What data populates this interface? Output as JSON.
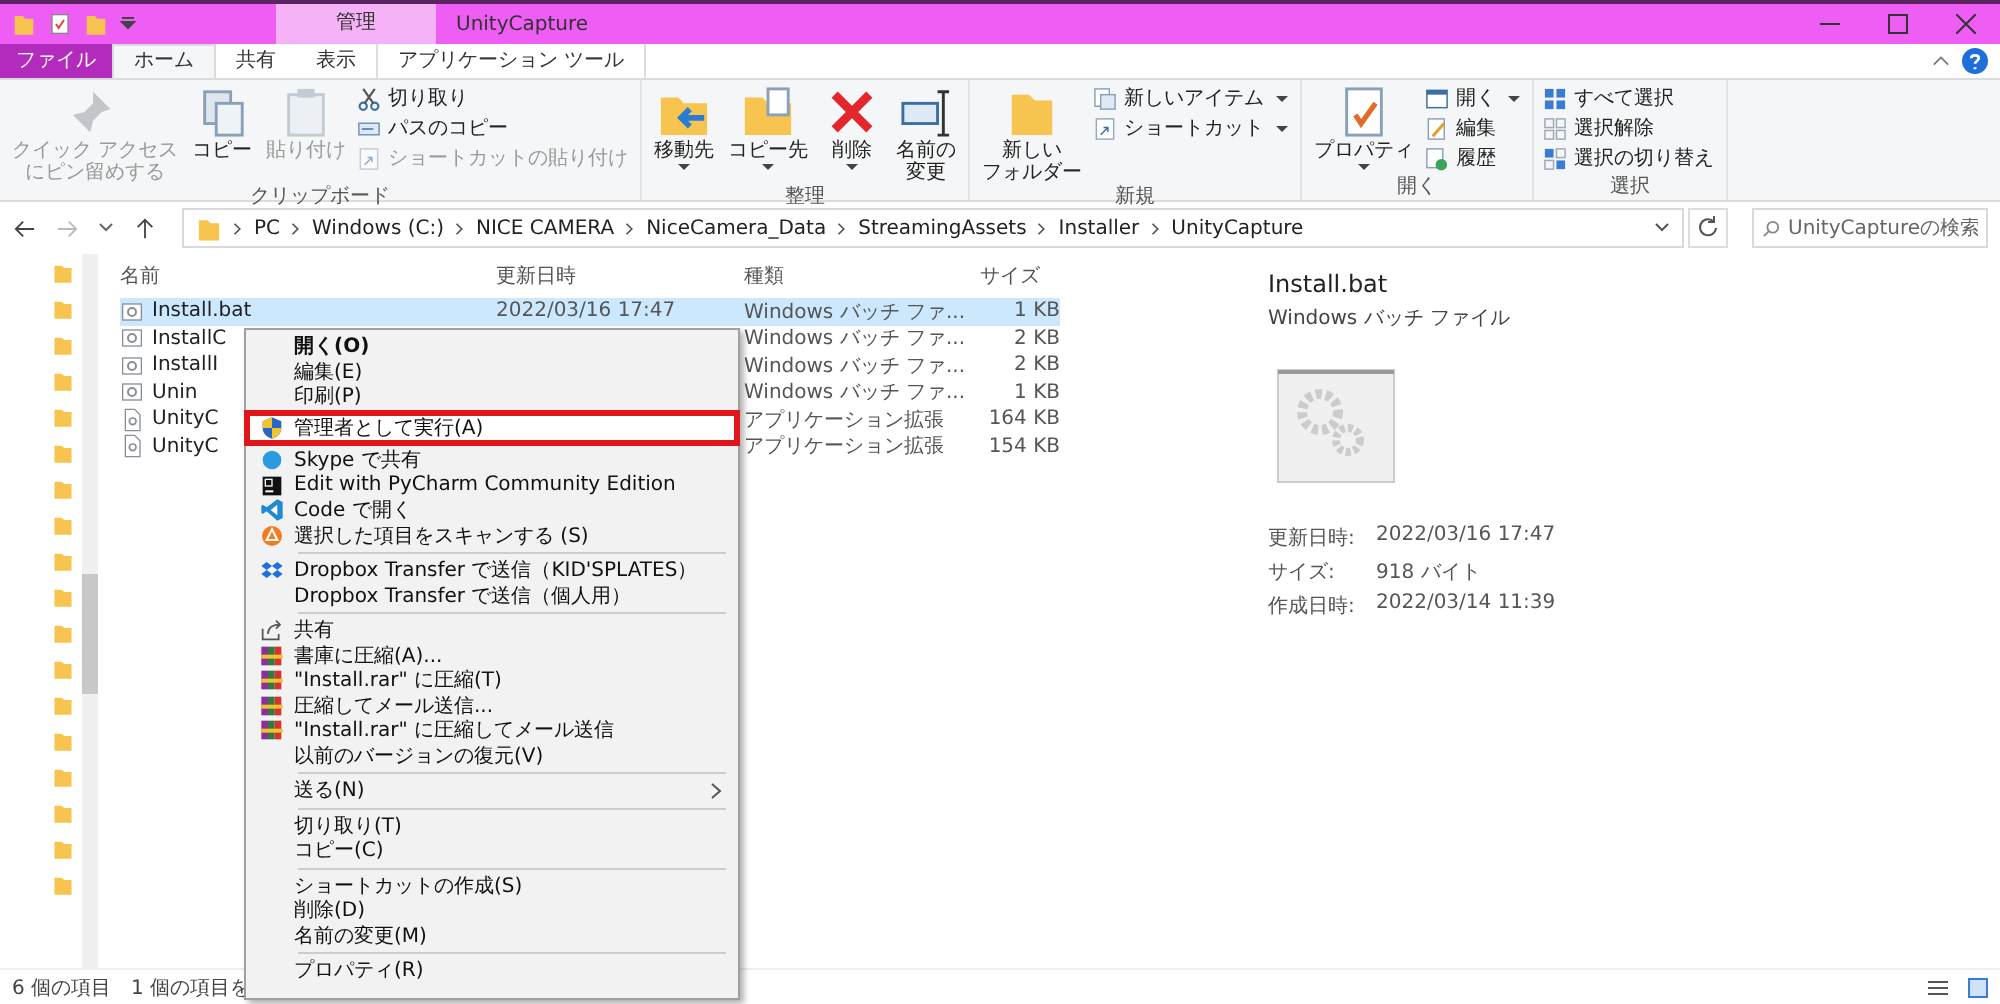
{
  "window": {
    "context_tab": "管理",
    "title": "UnityCapture"
  },
  "ribbon_tabs": [
    {
      "label": "ファイル",
      "kind": "file",
      "selected": false
    },
    {
      "label": "ホーム",
      "kind": "tab",
      "selected": true
    },
    {
      "label": "共有",
      "kind": "tab",
      "selected": false
    },
    {
      "label": "表示",
      "kind": "tab",
      "selected": false
    },
    {
      "label": "アプリケーション ツール",
      "kind": "context",
      "selected": false
    }
  ],
  "ribbon_groups": [
    {
      "label": "クリップボード",
      "controls": [
        {
          "kind": "large",
          "label": [
            "クイック アクセス",
            "にピン留めする"
          ],
          "disabled": true,
          "dropdown": false
        },
        {
          "kind": "large",
          "label": [
            "コピー"
          ],
          "disabled": false,
          "dropdown": false
        },
        {
          "kind": "large",
          "label": [
            "貼り付け"
          ],
          "disabled": true,
          "dropdown": false
        },
        {
          "kind": "stack",
          "items": [
            {
              "label": "切り取り",
              "disabled": false,
              "dropdown": false
            },
            {
              "label": "パスのコピー",
              "disabled": false,
              "dropdown": false
            },
            {
              "label": "ショートカットの貼り付け",
              "disabled": true,
              "dropdown": false
            }
          ]
        }
      ]
    },
    {
      "label": "整理",
      "controls": [
        {
          "kind": "large",
          "label": [
            "移動先"
          ],
          "disabled": false,
          "dropdown": true
        },
        {
          "kind": "large",
          "label": [
            "コピー先"
          ],
          "disabled": false,
          "dropdown": true
        },
        {
          "kind": "large",
          "label": [
            "削除"
          ],
          "disabled": false,
          "dropdown": true
        },
        {
          "kind": "large",
          "label": [
            "名前の",
            "変更"
          ],
          "disabled": false,
          "dropdown": false
        }
      ]
    },
    {
      "label": "新規",
      "controls": [
        {
          "kind": "large",
          "label": [
            "新しい",
            "フォルダー"
          ],
          "disabled": false,
          "dropdown": false
        },
        {
          "kind": "stack",
          "items": [
            {
              "label": "新しいアイテム",
              "disabled": false,
              "dropdown": true
            },
            {
              "label": "ショートカット",
              "disabled": false,
              "dropdown": true
            }
          ]
        }
      ]
    },
    {
      "label": "開く",
      "controls": [
        {
          "kind": "large",
          "label": [
            "プロパティ"
          ],
          "disabled": false,
          "dropdown": true
        },
        {
          "kind": "stack",
          "items": [
            {
              "label": "開く",
              "disabled": false,
              "dropdown": true
            },
            {
              "label": "編集",
              "disabled": false,
              "dropdown": false
            },
            {
              "label": "履歴",
              "disabled": false,
              "dropdown": false
            }
          ]
        }
      ]
    },
    {
      "label": "選択",
      "controls": [
        {
          "kind": "stack",
          "items": [
            {
              "label": "すべて選択",
              "disabled": false,
              "dropdown": false
            },
            {
              "label": "選択解除",
              "disabled": false,
              "dropdown": false
            },
            {
              "label": "選択の切り替え",
              "disabled": false,
              "dropdown": false
            }
          ]
        }
      ]
    }
  ],
  "address": {
    "path": [
      "PC",
      "Windows (C:)",
      "NICE CAMERA",
      "NiceCamera_Data",
      "StreamingAssets",
      "Installer",
      "UnityCapture"
    ],
    "search": {
      "placeholder": "UnityCaptureの検索"
    }
  },
  "table": {
    "columns": [
      "名前",
      "更新日時",
      "種類",
      "サイズ"
    ],
    "rows": [
      {
        "name": "Install.bat",
        "modified": "2022/03/16 17:47",
        "type": "Windows バッチ ファ...",
        "size": "1 KB",
        "selected": true
      },
      {
        "name": "InstallC",
        "type": "Windows バッチ ファ...",
        "size": "2 KB",
        "selected": false
      },
      {
        "name": "InstallI",
        "type": "Windows バッチ ファ...",
        "size": "2 KB",
        "selected": false
      },
      {
        "name": "Unin",
        "type": "Windows バッチ ファ...",
        "size": "1 KB",
        "selected": false
      },
      {
        "name": "UnityC",
        "type": "アプリケーション拡張",
        "size": "164 KB",
        "selected": false
      },
      {
        "name": "UnityC",
        "type": "アプリケーション拡張",
        "size": "154 KB",
        "selected": false
      }
    ]
  },
  "details": {
    "name": "Install.bat",
    "type": "Windows バッチ ファイル",
    "properties": [
      {
        "label": "更新日時:",
        "value": "2022/03/16 17:47"
      },
      {
        "label": "サイズ:",
        "value": "918 バイト"
      },
      {
        "label": "作成日時:",
        "value": "2022/03/14 11:39"
      }
    ]
  },
  "context_menu": [
    {
      "kind": "item",
      "label": "開く(O)",
      "default": true,
      "highlighted": false,
      "submenu": false
    },
    {
      "kind": "item",
      "label": "編集(E)",
      "default": false,
      "highlighted": false,
      "submenu": false
    },
    {
      "kind": "item",
      "label": "印刷(P)",
      "default": false,
      "highlighted": false,
      "submenu": false
    },
    {
      "kind": "item",
      "label": "管理者として実行(A)",
      "default": false,
      "highlighted": true,
      "submenu": false
    },
    {
      "kind": "item",
      "label": "Skype で共有",
      "default": false,
      "highlighted": false,
      "submenu": false
    },
    {
      "kind": "item",
      "label": "Edit with PyCharm Community Edition",
      "default": false,
      "highlighted": false,
      "submenu": false
    },
    {
      "kind": "item",
      "label": "Code で開く",
      "default": false,
      "highlighted": false,
      "submenu": false
    },
    {
      "kind": "item",
      "label": "選択した項目をスキャンする (S)",
      "default": false,
      "highlighted": false,
      "submenu": false
    },
    {
      "kind": "separator"
    },
    {
      "kind": "item",
      "label": "Dropbox Transfer で送信（KID'SPLATES）",
      "default": false,
      "highlighted": false,
      "submenu": false
    },
    {
      "kind": "item",
      "label": "Dropbox Transfer で送信（個人用）",
      "default": false,
      "highlighted": false,
      "submenu": false
    },
    {
      "kind": "separator"
    },
    {
      "kind": "item",
      "label": "共有",
      "default": false,
      "highlighted": false,
      "submenu": false
    },
    {
      "kind": "item",
      "label": "書庫に圧縮(A)...",
      "default": false,
      "highlighted": false,
      "submenu": false
    },
    {
      "kind": "item",
      "label": "\"Install.rar\" に圧縮(T)",
      "default": false,
      "highlighted": false,
      "submenu": false
    },
    {
      "kind": "item",
      "label": "圧縮してメール送信...",
      "default": false,
      "highlighted": false,
      "submenu": false
    },
    {
      "kind": "item",
      "label": "\"Install.rar\" に圧縮してメール送信",
      "default": false,
      "highlighted": false,
      "submenu": false
    },
    {
      "kind": "item",
      "label": "以前のバージョンの復元(V)",
      "default": false,
      "highlighted": false,
      "submenu": false
    },
    {
      "kind": "separator"
    },
    {
      "kind": "item",
      "label": "送る(N)",
      "default": false,
      "highlighted": false,
      "submenu": true
    },
    {
      "kind": "separator"
    },
    {
      "kind": "item",
      "label": "切り取り(T)",
      "default": false,
      "highlighted": false,
      "submenu": false
    },
    {
      "kind": "item",
      "label": "コピー(C)",
      "default": false,
      "highlighted": false,
      "submenu": false
    },
    {
      "kind": "separator"
    },
    {
      "kind": "item",
      "label": "ショートカットの作成(S)",
      "default": false,
      "highlighted": false,
      "submenu": false
    },
    {
      "kind": "item",
      "label": "削除(D)",
      "default": false,
      "highlighted": false,
      "submenu": false
    },
    {
      "kind": "item",
      "label": "名前の変更(M)",
      "default": false,
      "highlighted": false,
      "submenu": false
    },
    {
      "kind": "separator"
    },
    {
      "kind": "item",
      "label": "プロパティ(R)",
      "default": false,
      "highlighted": false,
      "submenu": false
    }
  ],
  "status_bar": [
    "6 個の項目",
    "1 個の項目を"
  ]
}
